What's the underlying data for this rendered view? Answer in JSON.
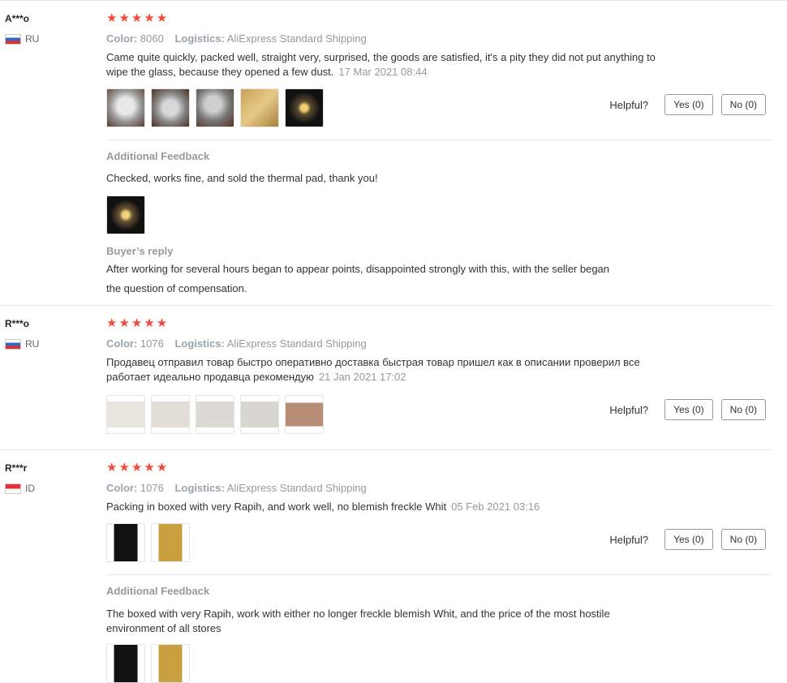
{
  "reviews": [
    {
      "user": "A***o",
      "country": "RU",
      "rating": "★★★★★",
      "color_label": "Color:",
      "color_value": "8060",
      "logistics_label": "Logistics:",
      "logistics_value": "AliExpress Standard Shipping",
      "text_line1": "Came quite quickly, packed well, straight very, surprised, the goods are satisfied, it's a pity they did not put anything to",
      "text_line2": "wipe the glass, because they opened a few dust.",
      "date": "17 Mar 2021 08:44",
      "helpful_label": "Helpful?",
      "yes_label": "Yes (0)",
      "no_label": "No (0)",
      "additional_title": "Additional Feedback",
      "additional_text": "Checked, works fine, and sold the thermal pad, thank you!",
      "reply_title": "Buyer’s reply",
      "reply_line1": "After working for several hours began to appear points, disappointed strongly with this, with the seller began",
      "reply_line2": "the question of compensation."
    },
    {
      "user": "R***o",
      "country": "RU",
      "rating": "★★★★★",
      "color_label": "Color:",
      "color_value": "1076",
      "logistics_label": "Logistics:",
      "logistics_value": "AliExpress Standard Shipping",
      "text_line1": "Продавец отправил товар быстро оперативно доставка быстрая товар пришел как в описании проверил все",
      "text_line2": "работает идеально продавца рекомендую",
      "date": "21 Jan 2021 17:02",
      "helpful_label": "Helpful?",
      "yes_label": "Yes (0)",
      "no_label": "No (0)"
    },
    {
      "user": "R***r",
      "country": "ID",
      "rating": "★★★★★",
      "color_label": "Color:",
      "color_value": "1076",
      "logistics_label": "Logistics:",
      "logistics_value": "AliExpress Standard Shipping",
      "text_line1": "Packing in boxed with very Rapih, and work well, no blemish freckle Whit",
      "date": "05 Feb 2021 03:16",
      "helpful_label": "Helpful?",
      "yes_label": "Yes (0)",
      "no_label": "No (0)",
      "additional_title": "Additional Feedback",
      "additional_line1": "The boxed with very Rapih, work with either no longer freckle blemish Whit, and the price of the most hostile",
      "additional_line2": "environment of all stores"
    }
  ]
}
